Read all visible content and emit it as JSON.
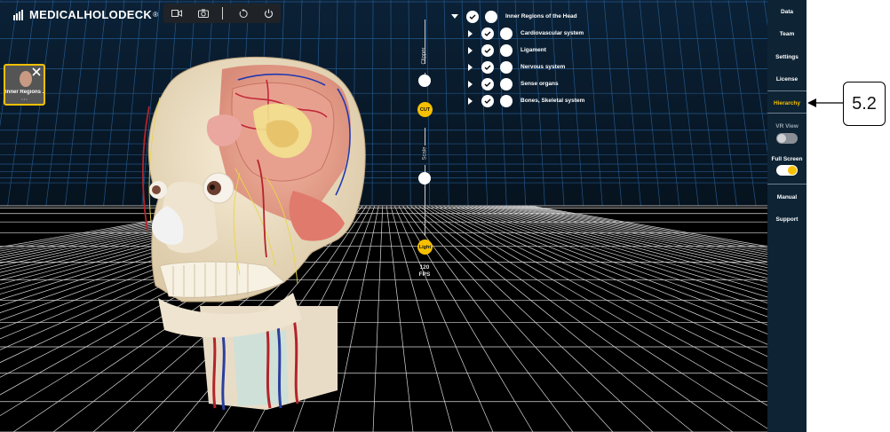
{
  "app": {
    "title": "MEDICALHOLODECK",
    "trademark": "®"
  },
  "toolbar": {
    "icons": [
      "video-icon",
      "camera-icon",
      "rotate-icon",
      "power-icon"
    ]
  },
  "thumbnail": {
    "label": "Inner Regions ...",
    "sub": "• • •"
  },
  "controls": {
    "clipper_label": "Clipper",
    "cut_label": "CUT",
    "scale_label": "Scale",
    "light_label": "Light",
    "fps_value": "120",
    "fps_unit": "FPS"
  },
  "hierarchy": {
    "root": "Inner Regions of the Head",
    "items": [
      {
        "label": "Cardiovascular system"
      },
      {
        "label": "Ligament"
      },
      {
        "label": "Nervous system"
      },
      {
        "label": "Sense organs"
      },
      {
        "label": "Bones, Skeletal system"
      }
    ]
  },
  "sidebar": {
    "data": "Data",
    "team": "Team",
    "settings": "Settings",
    "license": "License",
    "hierarchy": "Hierarchy",
    "vr_view": "VR View",
    "vr_view_on": false,
    "full_screen": "Full Screen",
    "full_screen_on": true,
    "manual": "Manual",
    "support": "Support"
  },
  "annotation": {
    "label": "5.2"
  },
  "colors": {
    "accent": "#f6c000",
    "sidebar_bg": "#0e2435",
    "grid": "#2c6aa8"
  }
}
